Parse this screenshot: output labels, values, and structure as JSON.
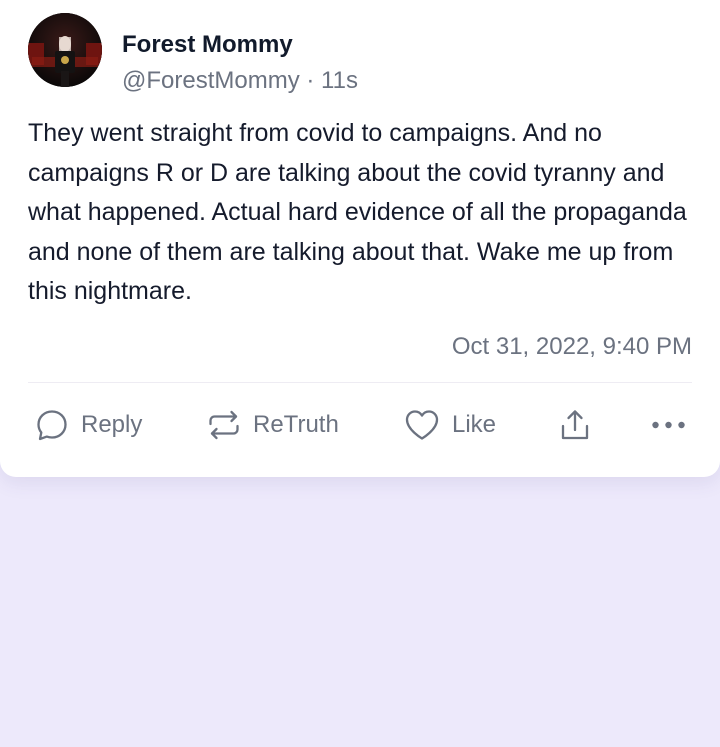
{
  "post": {
    "author": {
      "display_name": "Forest Mommy",
      "handle": "@ForestMommy",
      "separator": "·",
      "age": "11s"
    },
    "text": "They went straight from covid to campaigns.  And no campaigns R or D are talking about the covid tyranny and what happened.  Actual hard evidence of all the propaganda and none of them are talking about that.  Wake me up from this nightmare.",
    "timestamp": "Oct 31, 2022, 9:40 PM"
  },
  "actions": {
    "reply_label": "Reply",
    "retruth_label": "ReTruth",
    "like_label": "Like",
    "icons": [
      "reply-icon",
      "retruth-icon",
      "like-icon",
      "share-icon",
      "more-icon"
    ]
  },
  "colors": {
    "background": "#ede9fb",
    "card": "#ffffff",
    "text": "#151b2c",
    "muted": "#6b7280"
  }
}
